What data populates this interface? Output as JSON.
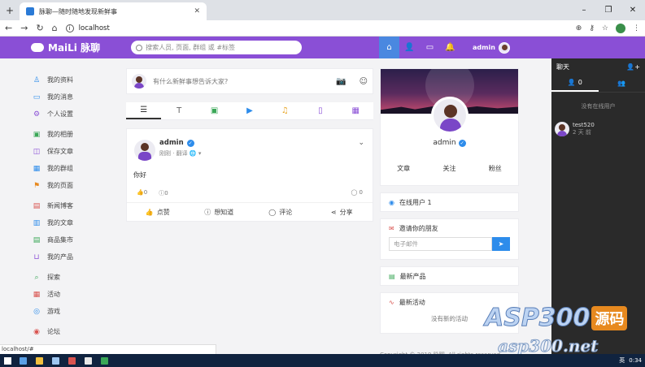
{
  "browser": {
    "tab_title": "脉聊—随时随地发现新鲜事",
    "url": "localhost",
    "status_url": "localhost/#"
  },
  "header": {
    "logo_text": "MaiLi 脉聊",
    "search_placeholder": "搜索人员, 页面, 群组 或 #标签",
    "username": "admin"
  },
  "sidebar": {
    "items": [
      {
        "label": "我的资料",
        "icon": "user-icon",
        "color": "#2d8ceb"
      },
      {
        "label": "我的消息",
        "icon": "message-icon",
        "color": "#2d8ceb"
      },
      {
        "label": "个人设置",
        "icon": "gear-icon",
        "color": "#8a4fd6"
      },
      {
        "label": "我的相册",
        "icon": "image-icon",
        "color": "#3aa757"
      },
      {
        "label": "保存文章",
        "icon": "bookmark-icon",
        "color": "#8a4fd6"
      },
      {
        "label": "我的群组",
        "icon": "group-icon",
        "color": "#2d8ceb"
      },
      {
        "label": "我的页面",
        "icon": "flag-icon",
        "color": "#e7891f"
      },
      {
        "label": "新闻博客",
        "icon": "blog-icon",
        "color": "#d9534f"
      },
      {
        "label": "我的文章",
        "icon": "book-icon",
        "color": "#2d8ceb"
      },
      {
        "label": "商品集市",
        "icon": "shop-icon",
        "color": "#3aa757"
      },
      {
        "label": "我的产品",
        "icon": "cart-icon",
        "color": "#8a4fd6"
      },
      {
        "label": "探索",
        "icon": "search-icon",
        "color": "#3aa757"
      },
      {
        "label": "活动",
        "icon": "calendar-icon",
        "color": "#d9534f"
      },
      {
        "label": "游戏",
        "icon": "game-icon",
        "color": "#2d8ceb"
      },
      {
        "label": "论坛",
        "icon": "forum-icon",
        "color": "#d9534f"
      }
    ]
  },
  "composer": {
    "placeholder": "有什么新鲜事想告诉大家?"
  },
  "post": {
    "author": "admin",
    "meta": "刚刚 · 翻译 🌐 ▾",
    "body": "你好",
    "likes": "0",
    "wonders": "0",
    "comments": "0",
    "actions": [
      "点赞",
      "想知道",
      "评论",
      "分享"
    ]
  },
  "profile": {
    "name": "admin",
    "links": [
      "文章",
      "关注",
      "粉丝"
    ]
  },
  "online": {
    "label": "在线用户 1"
  },
  "invite": {
    "label": "邀请你的朋友",
    "placeholder": "电子邮件"
  },
  "latest_products": {
    "label": "最新产品"
  },
  "latest_events": {
    "label": "最新活动",
    "empty": "没有新的活动"
  },
  "footer": {
    "copyright": "Copyright © 2019 脉聊. All rights reserved."
  },
  "chat": {
    "title": "聊天",
    "tab_count": "0",
    "empty": "没有在线用户",
    "user": {
      "name": "test520",
      "time": "2 天 前"
    }
  },
  "watermark": {
    "main": "ASP300",
    "badge": "源码",
    "url": "asp300.net"
  },
  "taskbar": {
    "lang": "英",
    "time": "0:34"
  }
}
